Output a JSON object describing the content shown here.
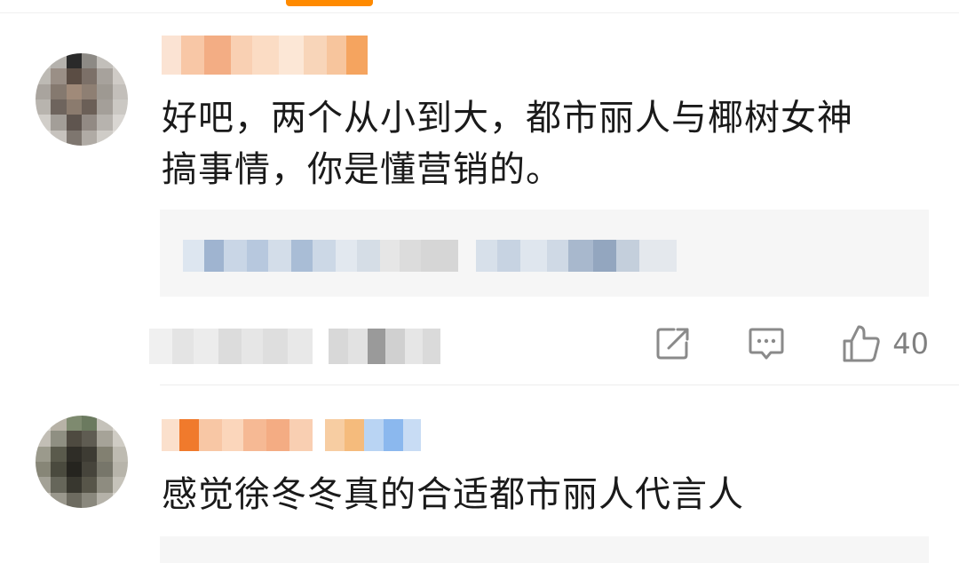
{
  "comments": [
    {
      "text_line1": "好吧，两个从小到大，都市丽人与椰树女神",
      "text_line2": "搞事情，你是懂营销的。",
      "like_count": "40",
      "actions": {
        "share_icon": "share-icon",
        "comment_icon": "comment-icon",
        "like_icon": "thumbs-up-icon"
      }
    },
    {
      "text_line1": "感觉徐冬冬真的合适都市丽人代言人"
    }
  ],
  "colors": {
    "accent": "#ff8a00",
    "text": "#1a1a1a",
    "icon": "#8a8a8a",
    "reply_bg": "#f6f6f6"
  }
}
